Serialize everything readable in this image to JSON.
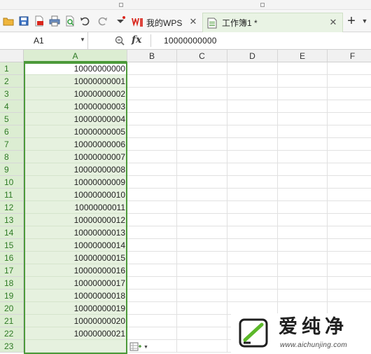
{
  "tabs": {
    "wps_label": "我的WPS",
    "workbook_label": "工作簿1 *"
  },
  "formula_bar": {
    "name_box": "A1",
    "fx_label": "fx",
    "value": "10000000000"
  },
  "columns": [
    "A",
    "B",
    "C",
    "D",
    "E",
    "F"
  ],
  "rows": [
    {
      "n": "1",
      "a": "10000000000"
    },
    {
      "n": "2",
      "a": "10000000001"
    },
    {
      "n": "3",
      "a": "10000000002"
    },
    {
      "n": "4",
      "a": "10000000003"
    },
    {
      "n": "5",
      "a": "10000000004"
    },
    {
      "n": "6",
      "a": "10000000005"
    },
    {
      "n": "7",
      "a": "10000000006"
    },
    {
      "n": "8",
      "a": "10000000007"
    },
    {
      "n": "9",
      "a": "10000000008"
    },
    {
      "n": "10",
      "a": "10000000009"
    },
    {
      "n": "11",
      "a": "10000000010"
    },
    {
      "n": "12",
      "a": "10000000011"
    },
    {
      "n": "13",
      "a": "10000000012"
    },
    {
      "n": "14",
      "a": "10000000013"
    },
    {
      "n": "15",
      "a": "10000000014"
    },
    {
      "n": "16",
      "a": "10000000015"
    },
    {
      "n": "17",
      "a": "10000000016"
    },
    {
      "n": "18",
      "a": "10000000017"
    },
    {
      "n": "19",
      "a": "10000000018"
    },
    {
      "n": "20",
      "a": "10000000019"
    },
    {
      "n": "21",
      "a": "10000000020"
    },
    {
      "n": "22",
      "a": "10000000021"
    },
    {
      "n": "23",
      "a": ""
    }
  ],
  "icons": {
    "toolbar": [
      "open-folder-icon",
      "save-icon",
      "export-pdf-icon",
      "print-icon",
      "print-preview-icon",
      "spellcheck-icon",
      "undo-icon",
      "redo-icon",
      "customize-dropdown-icon"
    ],
    "tab_wps": "wps-logo-icon",
    "tab_book": "spreadsheet-doc-icon",
    "new_tab": "plus-icon",
    "more_tabs": "chevron-down-icon",
    "zoom": "zoom-icon",
    "paste_options": "paste-options-icon"
  },
  "watermark": {
    "title": "爱纯净",
    "url": "www.aichunjing.com"
  },
  "colors": {
    "selection_green": "#4c9a3a",
    "selection_fill": "#e6f1df",
    "wps_red": "#d9261c",
    "header_bg": "#f1f1f1"
  }
}
